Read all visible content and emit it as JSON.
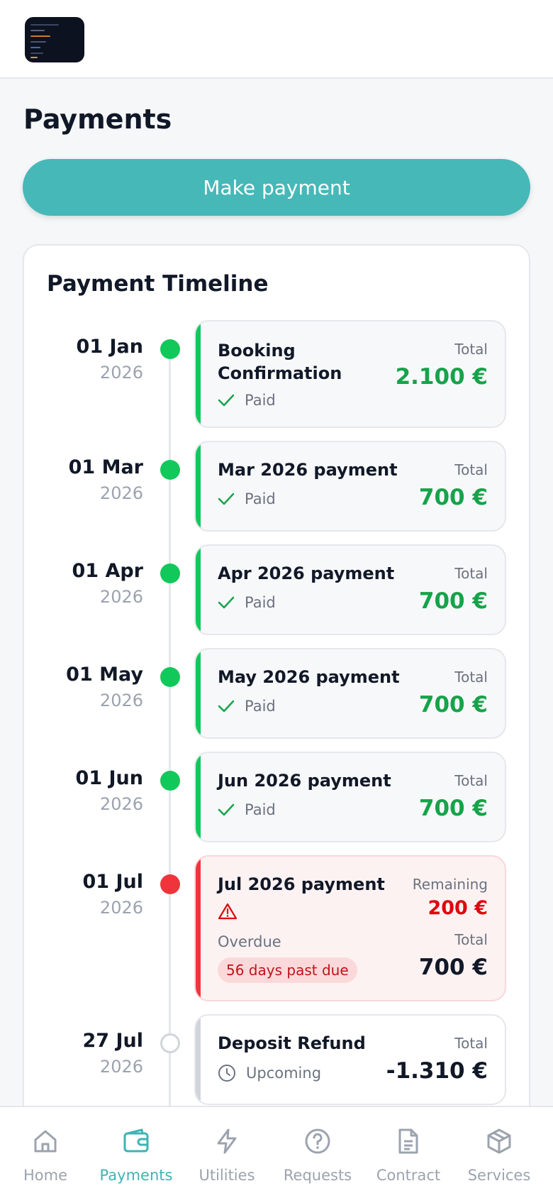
{
  "header": {
    "logo_icon": "app-logo"
  },
  "page": {
    "title": "Payments"
  },
  "actions": {
    "make_payment_label": "Make payment"
  },
  "timeline": {
    "title": "Payment Timeline",
    "items": [
      {
        "date": "01 Jan",
        "year": "2026",
        "name": "Booking\nConfirmation",
        "status": "Paid",
        "status_icon": "check-icon",
        "amount_label": "Total",
        "amount": "2.100 €"
      },
      {
        "date": "01 Mar",
        "year": "2026",
        "name": "Mar 2026 payment",
        "status": "Paid",
        "status_icon": "check-icon",
        "amount_label": "Total",
        "amount": "700 €"
      },
      {
        "date": "01 Apr",
        "year": "2026",
        "name": "Apr 2026 payment",
        "status": "Paid",
        "status_icon": "check-icon",
        "amount_label": "Total",
        "amount": "700 €"
      },
      {
        "date": "01 May",
        "year": "2026",
        "name": "May 2026 payment",
        "status": "Paid",
        "status_icon": "check-icon",
        "amount_label": "Total",
        "amount": "700 €"
      },
      {
        "date": "01 Jun",
        "year": "2026",
        "name": "Jun 2026 payment",
        "status": "Paid",
        "status_icon": "check-icon",
        "amount_label": "Total",
        "amount": "700 €"
      },
      {
        "date": "01 Jul",
        "year": "2026",
        "name": "Jul 2026 payment",
        "status": "Overdue",
        "status_icon": "warning-icon",
        "remaining_label": "Remaining",
        "remaining": "200 €",
        "amount_label": "Total",
        "amount": "700 €",
        "badge": "56 days past due"
      },
      {
        "date": "27 Jul",
        "year": "2026",
        "name": "Deposit Refund",
        "status": "Upcoming",
        "status_icon": "clock-icon",
        "amount_label": "Total",
        "amount": "-1.310 €"
      }
    ]
  },
  "nav": {
    "items": [
      {
        "label": "Home",
        "icon": "home-icon"
      },
      {
        "label": "Payments",
        "icon": "wallet-icon",
        "active": true
      },
      {
        "label": "Utilities",
        "icon": "bolt-icon"
      },
      {
        "label": "Requests",
        "icon": "question-circle-icon"
      },
      {
        "label": "Contract",
        "icon": "document-icon"
      },
      {
        "label": "Services",
        "icon": "box-icon"
      }
    ]
  },
  "colors": {
    "accent": "#46b8b8",
    "paid": "#16a34a",
    "overdue": "#e0060f",
    "nav_active": "#3fb3b3"
  }
}
